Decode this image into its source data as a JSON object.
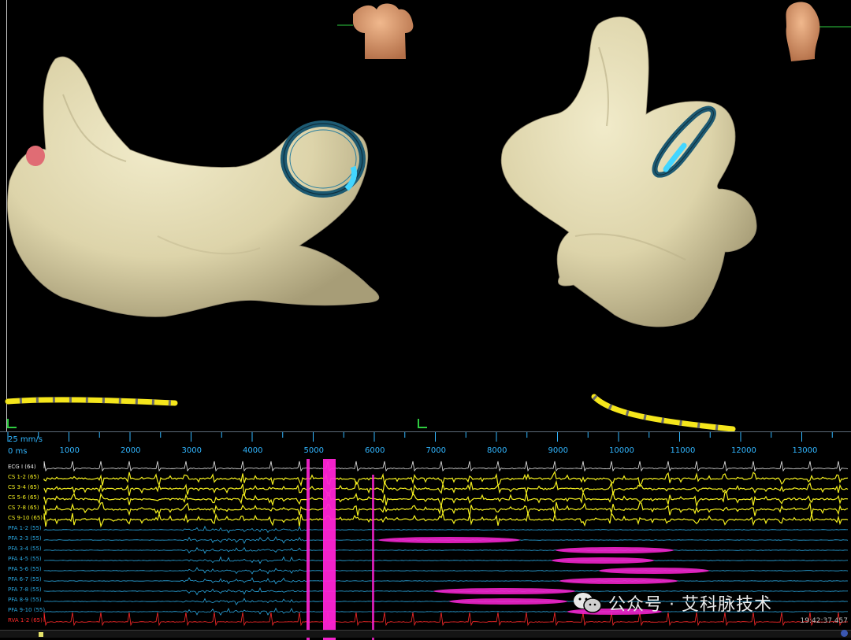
{
  "timeline": {
    "speed": "25 mm/s",
    "origin": "0 ms",
    "ticks": [
      "1000",
      "2000",
      "3000",
      "4000",
      "5000",
      "6000",
      "7000",
      "8000",
      "9000",
      "10000",
      "11000",
      "12000",
      "13000"
    ]
  },
  "channels": [
    {
      "label": "ECG I (64)",
      "color": "#e8e8e8"
    },
    {
      "label": "CS 1-2 (65)",
      "color": "#f3ee1f"
    },
    {
      "label": "CS 3-4 (65)",
      "color": "#f3ee1f"
    },
    {
      "label": "CS 5-6 (65)",
      "color": "#f3ee1f"
    },
    {
      "label": "CS 7-8 (65)",
      "color": "#f3ee1f"
    },
    {
      "label": "CS 9-10 (65)",
      "color": "#f3ee1f"
    },
    {
      "label": "PFA 1-2 (55)",
      "color": "#2aa7e0"
    },
    {
      "label": "PFA 2-3 (55)",
      "color": "#2aa7e0"
    },
    {
      "label": "PFA 3-4 (55)",
      "color": "#2aa7e0"
    },
    {
      "label": "PFA 4-5 (55)",
      "color": "#2aa7e0"
    },
    {
      "label": "PFA 5-6 (55)",
      "color": "#2aa7e0"
    },
    {
      "label": "PFA 6-7 (55)",
      "color": "#2aa7e0"
    },
    {
      "label": "PFA 7-8 (55)",
      "color": "#2aa7e0"
    },
    {
      "label": "PFA 8-9 (55)",
      "color": "#2aa7e0"
    },
    {
      "label": "PFA 9-10 (55)",
      "color": "#2aa7e0"
    },
    {
      "label": "RVA 1-2 (65)",
      "color": "#ff2a2a"
    }
  ],
  "timestamp": "19:42:37.457",
  "watermark": "公众号 · 艾科脉技术",
  "colors": {
    "chamber": "#e4dcb4",
    "catheter": "#f5e61c",
    "ablation": "#ff23d5",
    "timeline": "#31b6ff",
    "torso": "#d8976b"
  }
}
